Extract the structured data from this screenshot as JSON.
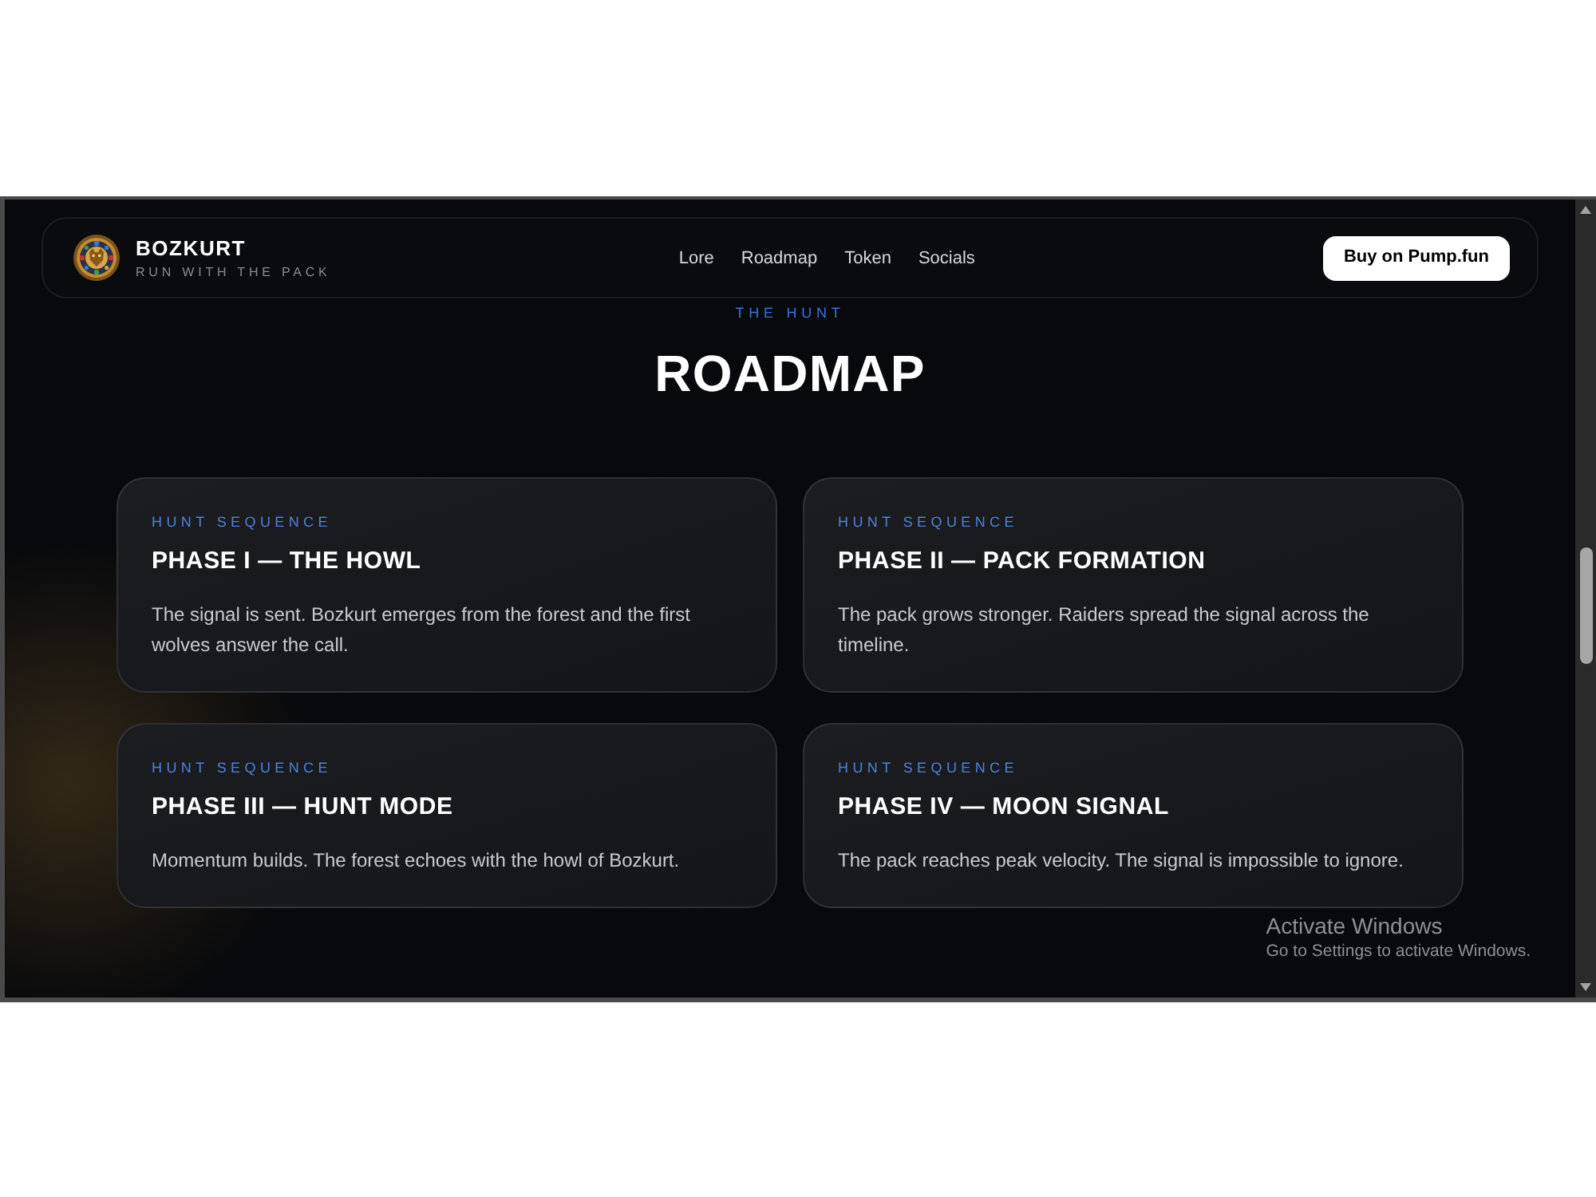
{
  "brand": {
    "name": "BOZKURT",
    "tagline": "RUN WITH THE PACK"
  },
  "nav": {
    "links": [
      {
        "label": "Lore"
      },
      {
        "label": "Roadmap"
      },
      {
        "label": "Token"
      },
      {
        "label": "Socials"
      }
    ],
    "cta": "Buy on Pump.fun"
  },
  "section": {
    "eyebrow": "THE HUNT",
    "title": "ROADMAP"
  },
  "phases": [
    {
      "label": "HUNT SEQUENCE",
      "title": "PHASE I — THE HOWL",
      "description": "The signal is sent. Bozkurt emerges from the forest and the first wolves answer the call."
    },
    {
      "label": "HUNT SEQUENCE",
      "title": "PHASE II — PACK FORMATION",
      "description": "The pack grows stronger. Raiders spread the signal across the timeline."
    },
    {
      "label": "HUNT SEQUENCE",
      "title": "PHASE III — HUNT MODE",
      "description": "Momentum builds. The forest echoes with the howl of Bozkurt."
    },
    {
      "label": "HUNT SEQUENCE",
      "title": "PHASE IV — MOON SIGNAL",
      "description": "The pack reaches peak velocity. The signal is impossible to ignore."
    }
  ],
  "os_overlay": {
    "title": "Activate Windows",
    "subtitle": "Go to Settings to activate Windows."
  }
}
